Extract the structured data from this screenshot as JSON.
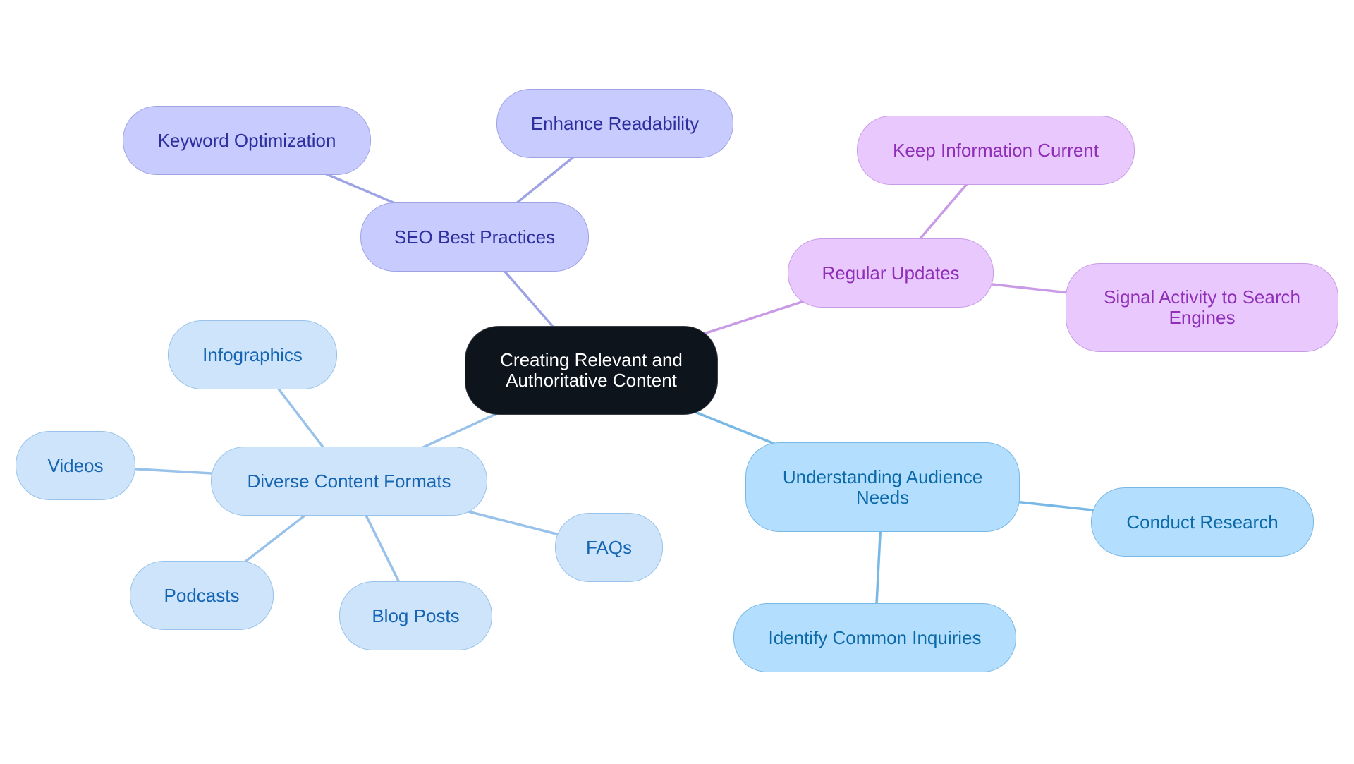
{
  "diagram": {
    "type": "mindmap",
    "root": {
      "id": "root",
      "label": "Creating Relevant and Authoritative Content"
    },
    "branches": [
      {
        "id": "seo",
        "label": "SEO Best Practices",
        "color": "#9ea3e6",
        "children": [
          {
            "id": "seo-kw",
            "label": "Keyword Optimization"
          },
          {
            "id": "seo-read",
            "label": "Enhance Readability"
          }
        ]
      },
      {
        "id": "upd",
        "label": "Regular Updates",
        "color": "#c99be6",
        "children": [
          {
            "id": "upd-keep",
            "label": "Keep Information Current"
          },
          {
            "id": "upd-signal",
            "label": "Signal Activity to Search Engines"
          }
        ]
      },
      {
        "id": "aud",
        "label": "Understanding Audience Needs",
        "color": "#78b8e6",
        "children": [
          {
            "id": "aud-research",
            "label": "Conduct Research"
          },
          {
            "id": "aud-inq",
            "label": "Identify Common Inquiries"
          }
        ]
      },
      {
        "id": "fmt",
        "label": "Diverse Content Formats",
        "color": "#98c2ea",
        "children": [
          {
            "id": "fmt-info",
            "label": "Infographics"
          },
          {
            "id": "fmt-videos",
            "label": "Videos"
          },
          {
            "id": "fmt-podcasts",
            "label": "Podcasts"
          },
          {
            "id": "fmt-blog",
            "label": "Blog Posts"
          },
          {
            "id": "fmt-faqs",
            "label": "FAQs"
          }
        ]
      }
    ]
  }
}
